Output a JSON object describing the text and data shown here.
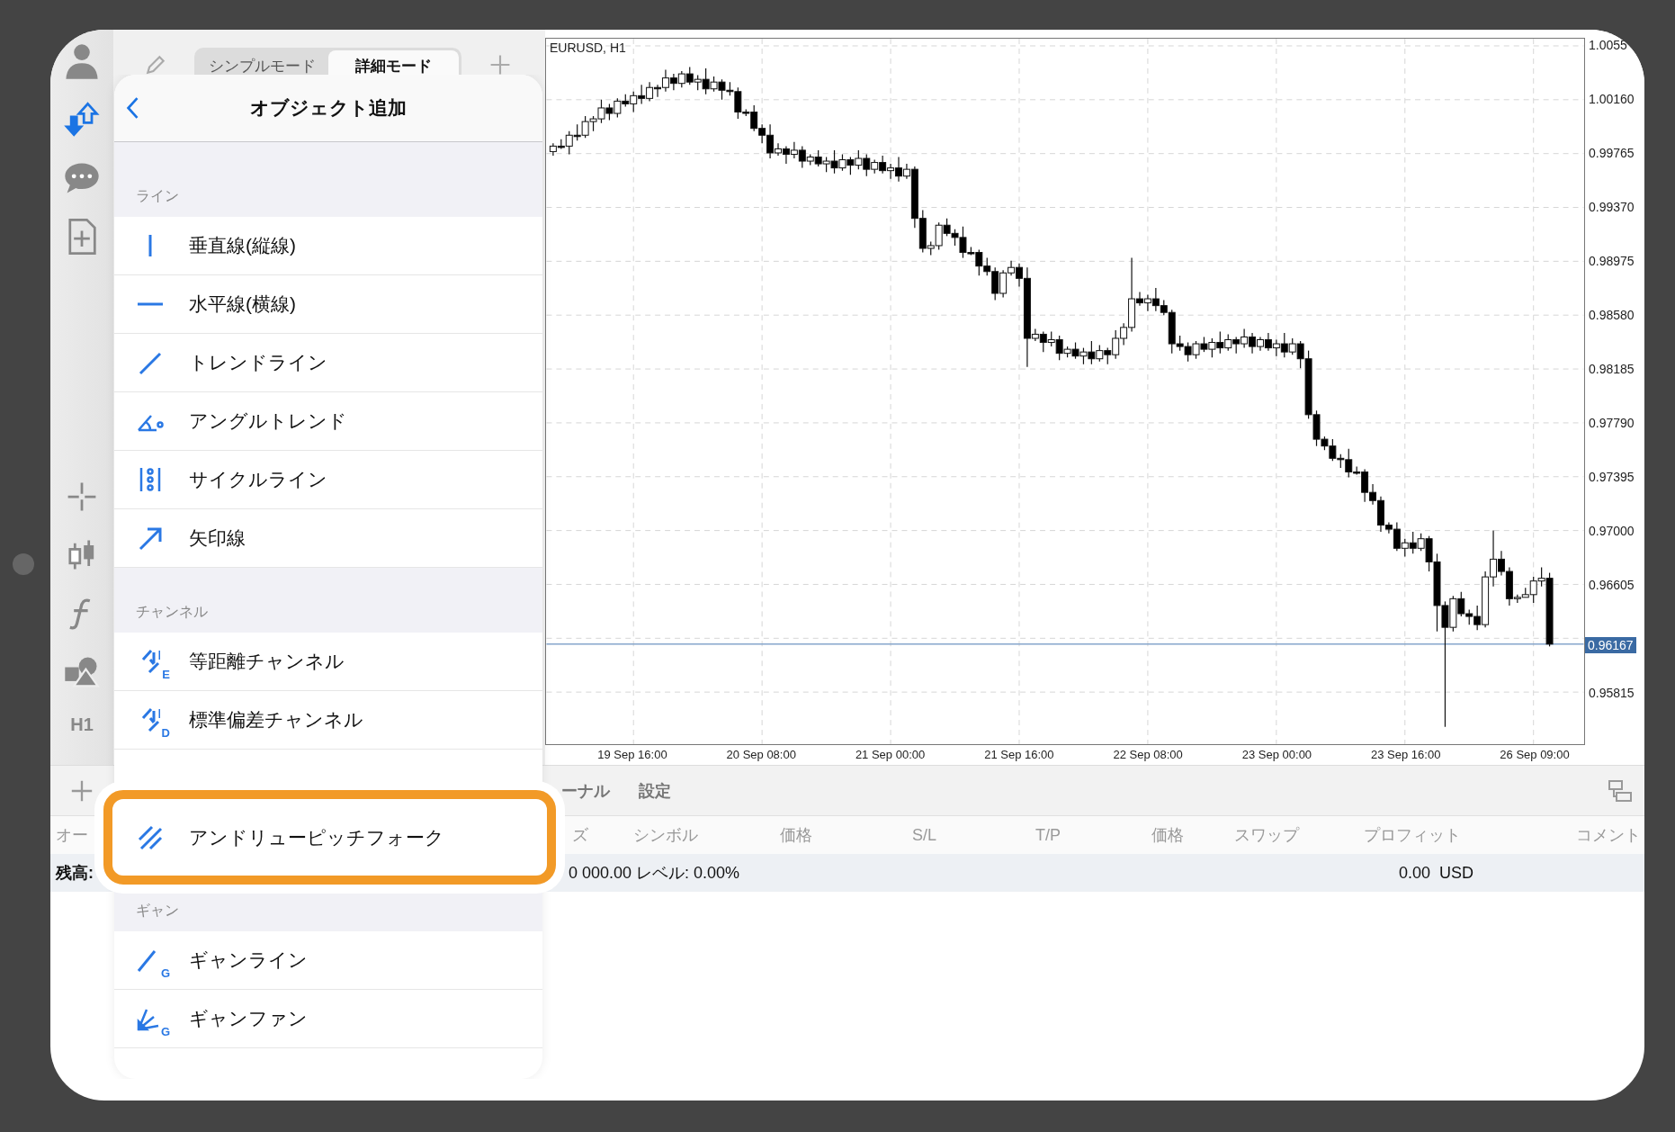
{
  "toolbar": {
    "timeframe": "H1"
  },
  "mode_tabs": [
    {
      "label": "シンプルモード",
      "selected": false
    },
    {
      "label": "詳細モード",
      "selected": true
    }
  ],
  "popover": {
    "title": "オブジェクト追加",
    "sections": [
      {
        "title": "ライン",
        "items": [
          {
            "label": "垂直線(縦線)",
            "kind": "vertical",
            "highlighted": false
          },
          {
            "label": "水平線(横線)",
            "kind": "horizontal",
            "highlighted": false
          },
          {
            "label": "トレンドライン",
            "kind": "trend",
            "highlighted": false
          },
          {
            "label": "アングルトレンド",
            "kind": "angle",
            "highlighted": false
          },
          {
            "label": "サイクルライン",
            "kind": "cycle",
            "highlighted": false
          },
          {
            "label": "矢印線",
            "kind": "arrow",
            "highlighted": false
          }
        ]
      },
      {
        "title": "チャンネル",
        "items": [
          {
            "label": "等距離チャンネル",
            "kind": "channel",
            "icon_text": "E",
            "highlighted": false
          },
          {
            "label": "標準偏差チャンネル",
            "kind": "channel",
            "icon_text": "D",
            "highlighted": false
          },
          {
            "label": "アンドリューピッチフォーク",
            "kind": "pitchfork",
            "highlighted": true
          }
        ]
      },
      {
        "title": "ギャン",
        "items": [
          {
            "label": "ギャンライン",
            "kind": "gann-line",
            "icon_text": "G",
            "highlighted": false
          },
          {
            "label": "ギャンファン",
            "kind": "gann-fan",
            "icon_text": "G",
            "highlighted": false
          }
        ]
      }
    ]
  },
  "chart": {
    "symbol": "EURUSD, H1",
    "chart_data": {
      "type": "candlestick",
      "ylim": [
        0.95433,
        1.00608
      ],
      "grid": true,
      "ref_lines": [
        {
          "axis": "y",
          "value": 0.96167,
          "label": "0.96167"
        }
      ],
      "categories": [
        null,
        null,
        null,
        null,
        null,
        null,
        null,
        null,
        null,
        null,
        "19 Sep 16:00",
        null,
        null,
        null,
        null,
        null,
        null,
        null,
        null,
        null,
        null,
        null,
        null,
        null,
        null,
        null,
        "20 Sep 08:00",
        null,
        null,
        null,
        null,
        null,
        null,
        null,
        null,
        null,
        null,
        null,
        null,
        null,
        null,
        null,
        "21 Sep 00:00",
        null,
        null,
        null,
        null,
        null,
        null,
        null,
        null,
        null,
        null,
        null,
        null,
        null,
        null,
        null,
        "21 Sep 16:00",
        null,
        null,
        null,
        null,
        null,
        null,
        null,
        null,
        null,
        null,
        null,
        null,
        null,
        null,
        null,
        "22 Sep 08:00",
        null,
        null,
        null,
        null,
        null,
        null,
        null,
        null,
        null,
        null,
        null,
        null,
        null,
        null,
        null,
        "23 Sep 00:00",
        null,
        null,
        null,
        null,
        null,
        null,
        null,
        null,
        null,
        null,
        null,
        null,
        null,
        null,
        null,
        "23 Sep 16:00",
        null,
        null,
        null,
        null,
        null,
        null,
        null,
        null,
        null,
        null,
        null,
        null,
        null,
        null,
        null,
        "26 Sep 09:00",
        null,
        null
      ],
      "yticks": [
        {
          "value": 1.00555,
          "label": "1.0055"
        },
        {
          "value": 1.0016,
          "label": "1.00160"
        },
        {
          "value": 0.99765,
          "label": "0.99765"
        },
        {
          "value": 0.9937,
          "label": "0.99370"
        },
        {
          "value": 0.98975,
          "label": "0.98975"
        },
        {
          "value": 0.9858,
          "label": "0.98580"
        },
        {
          "value": 0.98185,
          "label": "0.98185"
        },
        {
          "value": 0.9779,
          "label": "0.97790"
        },
        {
          "value": 0.97395,
          "label": "0.97395"
        },
        {
          "value": 0.97,
          "label": "0.97000"
        },
        {
          "value": 0.96605,
          "label": "0.96605"
        },
        {
          "value": 0.95815,
          "label": "0.95815"
        }
      ],
      "ohlc": [
        [
          0.9978,
          0.9984,
          0.9975,
          0.9982
        ],
        [
          0.9982,
          0.9987,
          0.998,
          0.9982
        ],
        [
          0.9982,
          0.9993,
          0.9976,
          0.999
        ],
        [
          0.999,
          0.9998,
          0.9986,
          0.999
        ],
        [
          0.999,
          1.0004,
          0.9988,
          1.0
        ],
        [
          1.0,
          1.0004,
          0.9993,
          1.0002
        ],
        [
          1.0002,
          1.0016,
          0.9999,
          1.001
        ],
        [
          1.001,
          1.0013,
          1.0001,
          1.0006
        ],
        [
          1.0006,
          1.0017,
          1.0003,
          1.0015
        ],
        [
          1.0015,
          1.002,
          1.0011,
          1.0013
        ],
        [
          1.0013,
          1.0022,
          1.0007,
          1.0019
        ],
        [
          1.0019,
          1.0027,
          1.0013,
          1.0017
        ],
        [
          1.0017,
          1.0029,
          1.0015,
          1.0025
        ],
        [
          1.0025,
          1.0027,
          1.0018,
          1.0025
        ],
        [
          1.0025,
          1.0038,
          1.0022,
          1.0032
        ],
        [
          1.0032,
          1.0035,
          1.0023,
          1.0028
        ],
        [
          1.0028,
          1.0037,
          1.0025,
          1.0035
        ],
        [
          1.0035,
          1.004,
          1.0027,
          1.0029
        ],
        [
          1.0029,
          1.0034,
          1.0023,
          1.0031
        ],
        [
          1.0031,
          1.0039,
          1.002,
          1.0024
        ],
        [
          1.0024,
          1.0033,
          1.0022,
          1.0029
        ],
        [
          1.0029,
          1.0031,
          1.0016,
          1.0023
        ],
        [
          1.0023,
          1.0029,
          1.0019,
          1.0022
        ],
        [
          1.0022,
          1.0025,
          1.0002,
          1.0007
        ],
        [
          1.0007,
          1.0009,
          1.0004,
          1.0007
        ],
        [
          1.0007,
          1.0012,
          0.9993,
          0.9995
        ],
        [
          0.9995,
          0.9998,
          0.9984,
          0.999
        ],
        [
          0.999,
          0.9998,
          0.9973,
          0.9977
        ],
        [
          0.9977,
          0.9984,
          0.9975,
          0.998
        ],
        [
          0.998,
          0.9982,
          0.9969,
          0.9976
        ],
        [
          0.9976,
          0.9985,
          0.9973,
          0.9979
        ],
        [
          0.9979,
          0.9982,
          0.9966,
          0.9971
        ],
        [
          0.9971,
          0.9976,
          0.9968,
          0.9974
        ],
        [
          0.9974,
          0.9979,
          0.9967,
          0.9969
        ],
        [
          0.9969,
          0.9974,
          0.9963,
          0.9971
        ],
        [
          0.9971,
          0.9979,
          0.9962,
          0.9966
        ],
        [
          0.9966,
          0.9976,
          0.9964,
          0.9972
        ],
        [
          0.9972,
          0.9974,
          0.9961,
          0.9968
        ],
        [
          0.9968,
          0.9979,
          0.9965,
          0.9973
        ],
        [
          0.9973,
          0.9976,
          0.996,
          0.9965
        ],
        [
          0.9965,
          0.9972,
          0.9962,
          0.997
        ],
        [
          0.997,
          0.9975,
          0.9962,
          0.9964
        ],
        [
          0.9964,
          0.9969,
          0.9958,
          0.9966
        ],
        [
          0.9966,
          0.9974,
          0.9956,
          0.996
        ],
        [
          0.996,
          0.9969,
          0.9958,
          0.9965
        ],
        [
          0.9965,
          0.9967,
          0.9922,
          0.9929
        ],
        [
          0.9929,
          0.9935,
          0.9904,
          0.9907
        ],
        [
          0.9907,
          0.9912,
          0.9902,
          0.9909
        ],
        [
          0.9909,
          0.9926,
          0.9906,
          0.9924
        ],
        [
          0.9924,
          0.9929,
          0.9916,
          0.9918
        ],
        [
          0.9918,
          0.9921,
          0.9909,
          0.9915
        ],
        [
          0.9915,
          0.9923,
          0.99,
          0.9904
        ],
        [
          0.9904,
          0.9908,
          0.9902,
          0.9904
        ],
        [
          0.9904,
          0.9906,
          0.9887,
          0.9894
        ],
        [
          0.9894,
          0.99,
          0.9887,
          0.989
        ],
        [
          0.989,
          0.9893,
          0.9869,
          0.9874
        ],
        [
          0.9874,
          0.9891,
          0.9871,
          0.9889
        ],
        [
          0.9889,
          0.9898,
          0.9887,
          0.9893
        ],
        [
          0.9893,
          0.9896,
          0.9879,
          0.9885
        ],
        [
          0.9885,
          0.9893,
          0.982,
          0.9841
        ],
        [
          0.9841,
          0.9848,
          0.9839,
          0.9844
        ],
        [
          0.9844,
          0.9846,
          0.9831,
          0.9838
        ],
        [
          0.9838,
          0.9846,
          0.9835,
          0.984
        ],
        [
          0.984,
          0.9843,
          0.9825,
          0.983
        ],
        [
          0.983,
          0.9835,
          0.9827,
          0.9833
        ],
        [
          0.9833,
          0.9838,
          0.9826,
          0.9828
        ],
        [
          0.9828,
          0.9834,
          0.9822,
          0.9831
        ],
        [
          0.9831,
          0.9839,
          0.9822,
          0.9826
        ],
        [
          0.9826,
          0.9836,
          0.9824,
          0.9832
        ],
        [
          0.9832,
          0.9834,
          0.9822,
          0.9829
        ],
        [
          0.9829,
          0.9847,
          0.9826,
          0.9841
        ],
        [
          0.9841,
          0.9852,
          0.9836,
          0.9849
        ],
        [
          0.9849,
          0.99,
          0.9846,
          0.987
        ],
        [
          0.987,
          0.9875,
          0.9865,
          0.9867
        ],
        [
          0.9867,
          0.9873,
          0.9861,
          0.987
        ],
        [
          0.987,
          0.9878,
          0.9861,
          0.9865
        ],
        [
          0.9865,
          0.9869,
          0.9858,
          0.986
        ],
        [
          0.986,
          0.9862,
          0.983,
          0.9837
        ],
        [
          0.9837,
          0.9843,
          0.9832,
          0.9835
        ],
        [
          0.9835,
          0.9838,
          0.9824,
          0.9829
        ],
        [
          0.9829,
          0.9839,
          0.9826,
          0.9837
        ],
        [
          0.9837,
          0.9842,
          0.9831,
          0.9833
        ],
        [
          0.9833,
          0.9841,
          0.9827,
          0.9838
        ],
        [
          0.9838,
          0.9846,
          0.983,
          0.9834
        ],
        [
          0.9834,
          0.9844,
          0.9832,
          0.984
        ],
        [
          0.984,
          0.9842,
          0.983,
          0.9837
        ],
        [
          0.9837,
          0.9848,
          0.9834,
          0.9842
        ],
        [
          0.9842,
          0.9845,
          0.983,
          0.9835
        ],
        [
          0.9835,
          0.9842,
          0.9832,
          0.984
        ],
        [
          0.984,
          0.9845,
          0.9832,
          0.9834
        ],
        [
          0.9834,
          0.984,
          0.9828,
          0.9837
        ],
        [
          0.9837,
          0.9845,
          0.9827,
          0.9831
        ],
        [
          0.9831,
          0.9841,
          0.9829,
          0.9837
        ],
        [
          0.9837,
          0.9839,
          0.9819,
          0.9826
        ],
        [
          0.9826,
          0.9832,
          0.9782,
          0.9785
        ],
        [
          0.9785,
          0.9788,
          0.9762,
          0.9767
        ],
        [
          0.9767,
          0.9769,
          0.9759,
          0.9762
        ],
        [
          0.9762,
          0.9767,
          0.9751,
          0.9753
        ],
        [
          0.9753,
          0.9756,
          0.9746,
          0.9752
        ],
        [
          0.9752,
          0.976,
          0.9739,
          0.9743
        ],
        [
          0.9743,
          0.9747,
          0.9741,
          0.9743
        ],
        [
          0.9743,
          0.9745,
          0.9721,
          0.9728
        ],
        [
          0.9728,
          0.9734,
          0.9719,
          0.9722
        ],
        [
          0.9722,
          0.9725,
          0.9699,
          0.9704
        ],
        [
          0.9704,
          0.9706,
          0.9698,
          0.9701
        ],
        [
          0.9701,
          0.9706,
          0.9685,
          0.9687
        ],
        [
          0.9687,
          0.9694,
          0.9681,
          0.9691
        ],
        [
          0.9691,
          0.9699,
          0.9683,
          0.9687
        ],
        [
          0.9687,
          0.9698,
          0.9685,
          0.9694
        ],
        [
          0.9694,
          0.9696,
          0.967,
          0.9677
        ],
        [
          0.9677,
          0.9683,
          0.9626,
          0.9645
        ],
        [
          0.9645,
          0.9648,
          0.9556,
          0.9629
        ],
        [
          0.9629,
          0.9652,
          0.9626,
          0.965
        ],
        [
          0.965,
          0.9655,
          0.9637,
          0.9639
        ],
        [
          0.9639,
          0.9642,
          0.9631,
          0.9637
        ],
        [
          0.9637,
          0.9645,
          0.9627,
          0.9631
        ],
        [
          0.9631,
          0.967,
          0.9629,
          0.9666
        ],
        [
          0.9666,
          0.97,
          0.9659,
          0.9679
        ],
        [
          0.9679,
          0.9685,
          0.9667,
          0.967
        ],
        [
          0.967,
          0.9673,
          0.9645,
          0.965
        ],
        [
          0.965,
          0.9653,
          0.9647,
          0.9651
        ],
        [
          0.9651,
          0.9658,
          0.9651,
          0.9653
        ],
        [
          0.9653,
          0.9666,
          0.9647,
          0.9663
        ],
        [
          0.9663,
          0.9673,
          0.9659,
          0.9665
        ],
        [
          0.9665,
          0.9669,
          0.9615,
          0.96167
        ]
      ]
    }
  },
  "bottom_panel": {
    "tabs": [
      "ーナル",
      "設定"
    ],
    "columns": [
      "オー",
      "ズ",
      "シンボル",
      "価格",
      "S/L",
      "T/P",
      "価格",
      "スワップ",
      "プロフィット",
      "コメント"
    ],
    "balance": {
      "label": "残高:",
      "text": "0 000.00 レベル: 0.00%",
      "profit": "0.00",
      "currency": "USD"
    }
  }
}
